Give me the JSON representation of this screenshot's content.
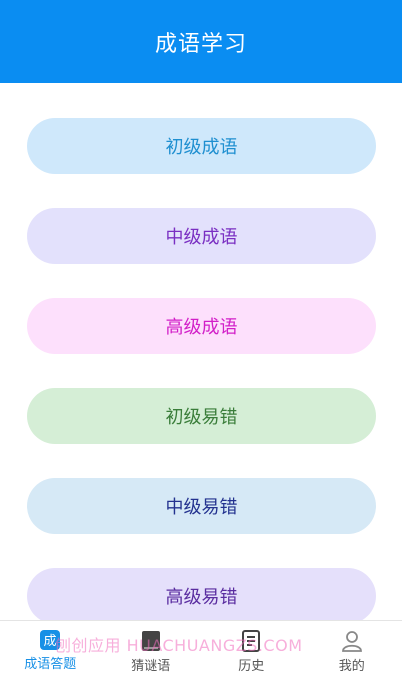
{
  "header": {
    "title": "成语学习"
  },
  "levels": [
    {
      "label": "初级成语",
      "bg": "#cfe8fb",
      "color": "#1f8fd0"
    },
    {
      "label": "中级成语",
      "bg": "#e3e1fc",
      "color": "#7a2fc2"
    },
    {
      "label": "高级成语",
      "bg": "#fde0fc",
      "color": "#d21fc8"
    },
    {
      "label": "初级易错",
      "bg": "#d5eed6",
      "color": "#3a7d3a"
    },
    {
      "label": "中级易错",
      "bg": "#d6e9f6",
      "color": "#23328f"
    },
    {
      "label": "高级易错",
      "bg": "#e5e0fb",
      "color": "#5a2da0"
    }
  ],
  "tabs": [
    {
      "label": "成语答题",
      "icon_text": "成",
      "icon": "idiom-quiz-icon",
      "active": true
    },
    {
      "label": "猜谜语",
      "icon": "book-icon"
    },
    {
      "label": "历史",
      "icon": "document-icon"
    },
    {
      "label": "我的",
      "icon": "user-icon"
    }
  ],
  "watermark": "刨创应用 HUACHUANGZS.COM",
  "colors": {
    "primary": "#0a8df2",
    "tab_active": "#1790e6",
    "tab_inactive": "#555555"
  }
}
